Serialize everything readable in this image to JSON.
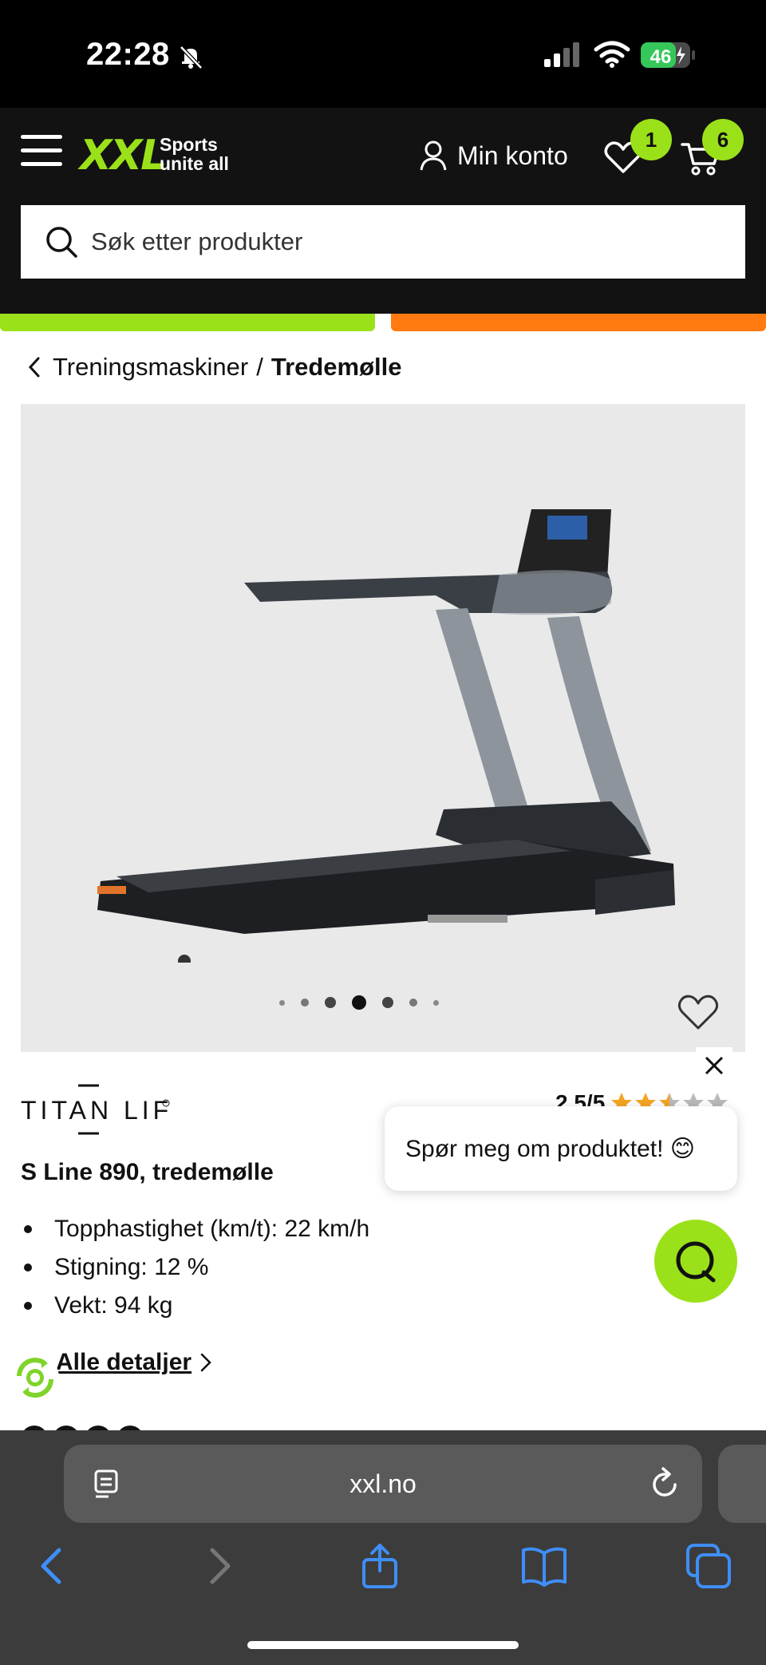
{
  "status_bar": {
    "time": "22:28",
    "battery": "46"
  },
  "header": {
    "logo": "XXL",
    "tagline_line1": "Sports",
    "tagline_line2": "unite all",
    "account_label": "Min konto",
    "wishlist_count": "1",
    "cart_count": "6",
    "search_placeholder": "Søk etter produkter"
  },
  "breadcrumb": {
    "parent": "Treningsmaskiner",
    "separator": "/",
    "current": "Tredemølle"
  },
  "product": {
    "brand": "TITAN LIFE",
    "rating_text": "2.5/5",
    "rating_value": 2.5,
    "rating_max": 5,
    "title": "S Line 890, tredemølle",
    "specs": [
      "Topphastighet (km/t): 22 km/h",
      "Stigning: 12 %",
      "Vekt: 94 kg"
    ],
    "all_details_label": "Alle detaljer",
    "image_count": 7,
    "image_active_index": 3
  },
  "chat": {
    "prompt": "Spør meg om produktet! 😊"
  },
  "browser": {
    "url": "xxl.no"
  },
  "colors": {
    "brand_green": "#9be11a",
    "accent_orange": "#ff7a10",
    "header_bg": "#121212"
  }
}
